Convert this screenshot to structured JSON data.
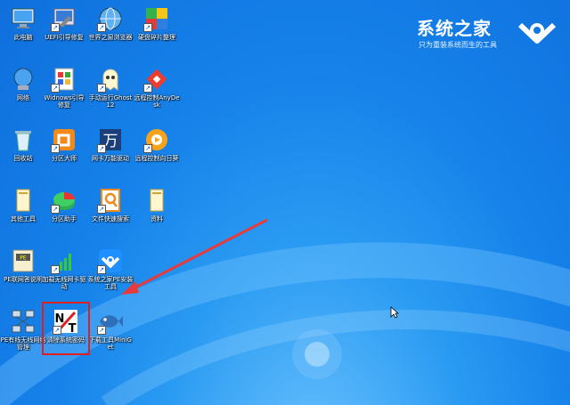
{
  "brand": {
    "title": "系统之家",
    "subtitle": "只为重装系统而生的工具"
  },
  "icons": [
    {
      "id": "this-pc",
      "label": "此电脑",
      "icon": "computer-icon",
      "shortcut": false
    },
    {
      "id": "uefi-repair",
      "label": "UEFI引导修复",
      "icon": "repair-icon",
      "shortcut": true
    },
    {
      "id": "world-browser",
      "label": "世界之窗浏览器",
      "icon": "globe-icon",
      "shortcut": true
    },
    {
      "id": "disk-defrag",
      "label": "硬盘碎片整理",
      "icon": "defrag-icon",
      "shortcut": true
    },
    {
      "id": "network",
      "label": "网络",
      "icon": "network-icon",
      "shortcut": false
    },
    {
      "id": "windows-boot-repair",
      "label": "Widnows引导修复",
      "icon": "boot-repair-icon",
      "shortcut": true
    },
    {
      "id": "ghost",
      "label": "手动运行Ghost12",
      "icon": "ghost-icon",
      "shortcut": true
    },
    {
      "id": "anydesk",
      "label": "远程控制AnyDesk",
      "icon": "anydesk-icon",
      "shortcut": true
    },
    {
      "id": "recycle-bin",
      "label": "回收站",
      "icon": "recycle-bin-icon",
      "shortcut": false
    },
    {
      "id": "diskgenius",
      "label": "分区大师",
      "icon": "diskgenius-icon",
      "shortcut": true
    },
    {
      "id": "netcard-driver",
      "label": "网卡万能驱动",
      "icon": "wan-driver-icon",
      "shortcut": true
    },
    {
      "id": "remote-sunflower",
      "label": "远程控制向日葵",
      "icon": "sunflower-icon",
      "shortcut": true
    },
    {
      "id": "other-tools",
      "label": "其他工具",
      "icon": "folder-icon",
      "shortcut": false
    },
    {
      "id": "partition-helper",
      "label": "分区助手",
      "icon": "partition-helper-icon",
      "shortcut": true
    },
    {
      "id": "file-search",
      "label": "文件快速搜索",
      "icon": "search-icon",
      "shortcut": true
    },
    {
      "id": "materials",
      "label": "资料",
      "icon": "folder-icon",
      "shortcut": false
    },
    {
      "id": "pe-network-help",
      "label": "PE联网答说明",
      "icon": "pe-doc-icon",
      "shortcut": false
    },
    {
      "id": "wireless-driver",
      "label": "加载无线网卡驱动",
      "icon": "wireless-signal-icon",
      "shortcut": true
    },
    {
      "id": "pe-install-tool",
      "label": "系统之家PE安装工具",
      "icon": "xtzj-logo-icon",
      "shortcut": true
    },
    {
      "id": "pe-wired-wireless",
      "label": "PE有线无线网络管理",
      "icon": "network-manager-icon",
      "shortcut": false
    },
    {
      "id": "clear-password",
      "label": "清除系统密码",
      "icon": "ntpwedit-icon",
      "shortcut": true
    },
    {
      "id": "miniget",
      "label": "下载工具MiniGet",
      "icon": "miniget-fish-icon",
      "shortcut": true
    }
  ],
  "colors": {
    "desktop": "#1682ea",
    "highlight": "#e02020",
    "arrow": "#e83a3a"
  }
}
